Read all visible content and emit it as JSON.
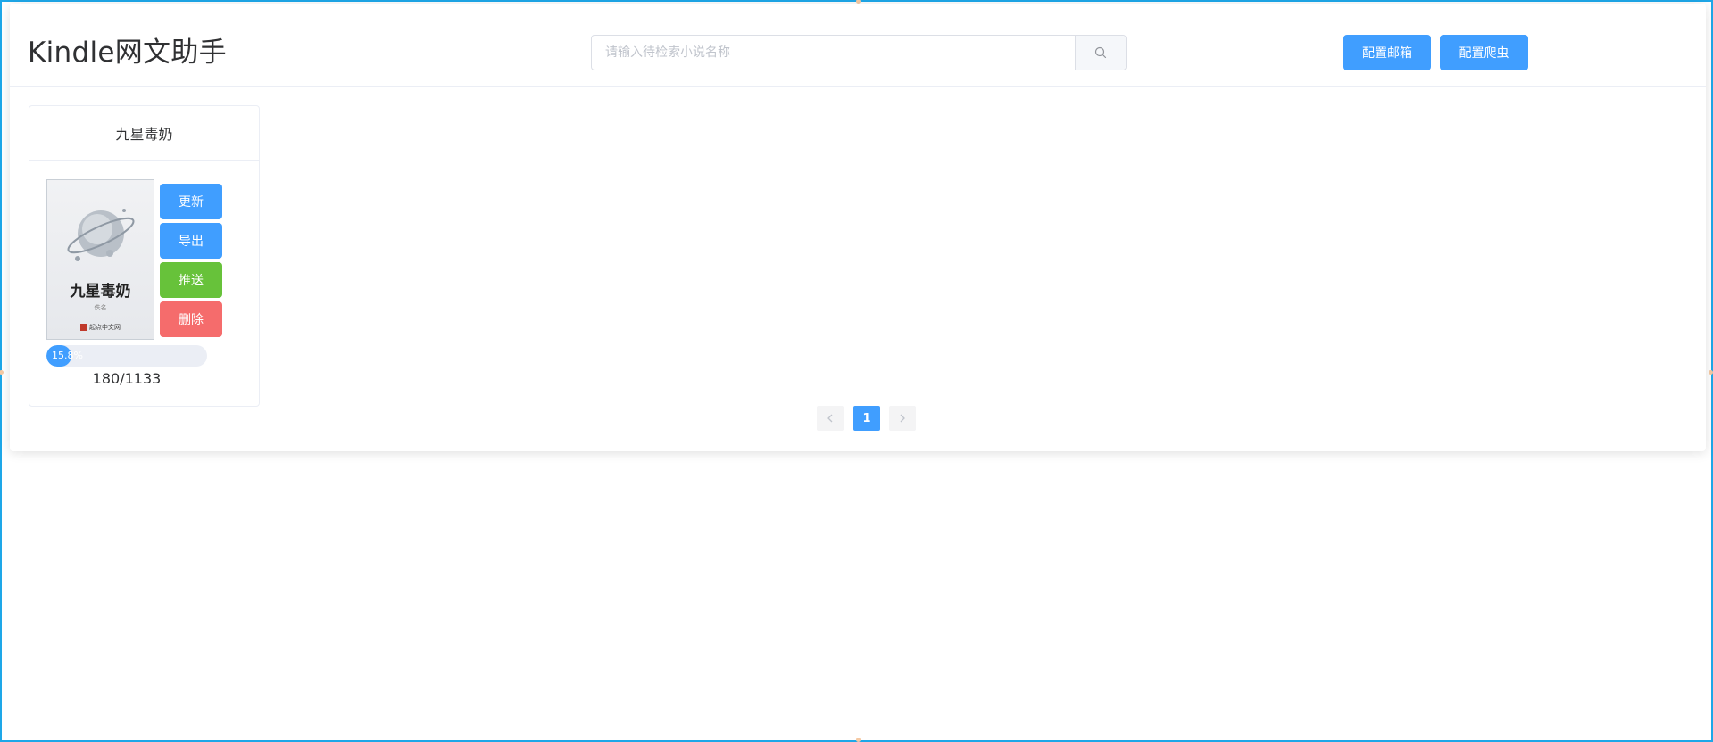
{
  "app": {
    "title": "Kindle网文助手"
  },
  "search": {
    "placeholder": "请输入待检索小说名称",
    "value": "",
    "icon": "search-icon"
  },
  "header_buttons": {
    "email_label": "配置邮箱",
    "crawler_label": "配置爬虫"
  },
  "book": {
    "title": "九星毒奶",
    "cover": {
      "title": "九星毒奶",
      "author": "佚名",
      "publisher": "起点中文网"
    },
    "actions": {
      "update": "更新",
      "export": "导出",
      "push": "推送",
      "delete": "删除"
    },
    "progress": {
      "percent": 15.8,
      "label": "15.8%",
      "count": "180/1133"
    }
  },
  "pagination": {
    "prev_icon": "chevron-left-icon",
    "current": "1",
    "next_icon": "chevron-right-icon"
  },
  "colors": {
    "primary": "#409eff",
    "success": "#67c23a",
    "danger": "#f56c6c",
    "border_accent": "#1ea7e8"
  }
}
